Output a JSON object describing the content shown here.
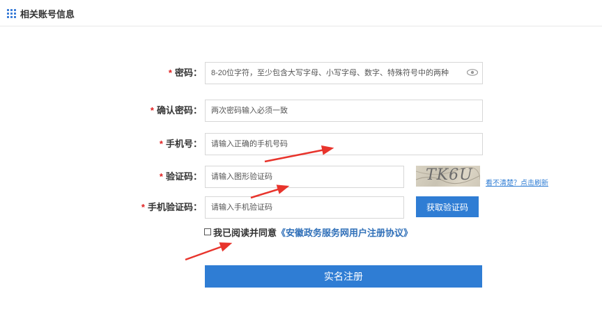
{
  "header": {
    "title": "相关账号信息"
  },
  "form": {
    "password": {
      "label": "密码：",
      "placeholder": "8-20位字符，至少包含大写字母、小写字母、数字、特殊符号中的两种"
    },
    "confirm_password": {
      "label": "确认密码：",
      "placeholder": "两次密码输入必须一致"
    },
    "phone": {
      "label": "手机号：",
      "placeholder": "请输入正确的手机号码"
    },
    "captcha": {
      "label": "验证码：",
      "placeholder": "请输入图形验证码",
      "image_text": "TK6U",
      "refresh_link": "看不清楚？点击刷新"
    },
    "sms_code": {
      "label": "手机验证码：",
      "placeholder": "请输入手机验证码",
      "button_label": "获取验证码"
    },
    "required_mark": "*"
  },
  "agreement": {
    "text": "我已阅读并同意",
    "link": "《安徽政务服务网用户注册协议》"
  },
  "submit": {
    "label": "实名注册"
  },
  "colors": {
    "accent": "#2f7dd4",
    "required": "#e02020",
    "annotation_arrow": "#e8342c"
  }
}
